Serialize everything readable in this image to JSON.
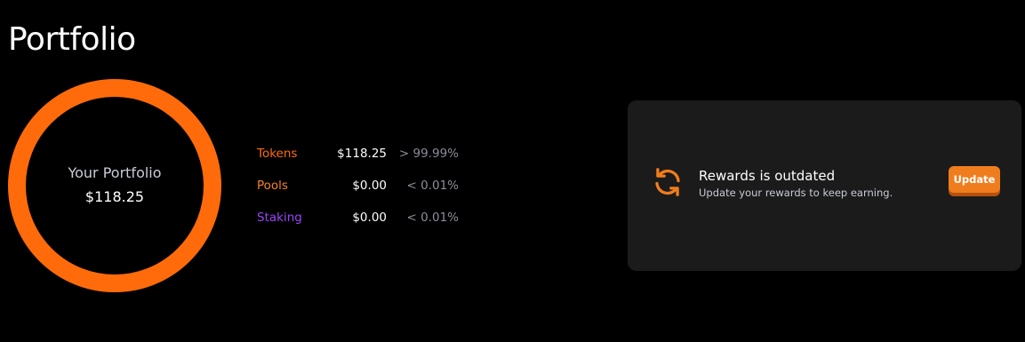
{
  "page": {
    "title": "Portfolio"
  },
  "portfolio": {
    "label": "Your Portfolio",
    "total": "$118.25",
    "ring_color": "#ff6b0a",
    "breakdown": [
      {
        "name": "Tokens",
        "amount": "$118.25",
        "percent": "> 99.99%",
        "color": "#ff6b0a"
      },
      {
        "name": "Pools",
        "amount": "$0.00",
        "percent": "< 0.01%",
        "color": "#f7822a"
      },
      {
        "name": "Staking",
        "amount": "$0.00",
        "percent": "< 0.01%",
        "color": "#9b43f5"
      }
    ]
  },
  "rewards": {
    "icon": "refresh-icon",
    "icon_color": "#f07d1d",
    "title": "Rewards is outdated",
    "subtitle": "Update your rewards to keep earning.",
    "button_label": "Update",
    "button_color": "#f07d1d"
  }
}
